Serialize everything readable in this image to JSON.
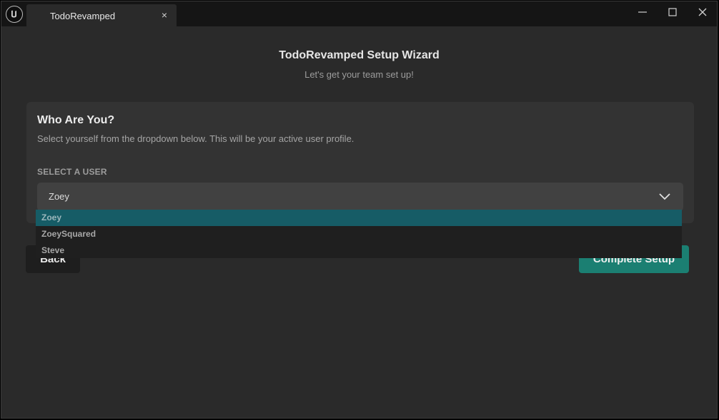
{
  "window": {
    "tab_title": "TodoRevamped",
    "tab_close": "×"
  },
  "wizard": {
    "title": "TodoRevamped Setup Wizard",
    "subtitle": "Let's get your team set up!"
  },
  "card": {
    "title": "Who Are You?",
    "description": "Select yourself from the dropdown below. This will be your active user profile.",
    "field_label": "SELECT A USER",
    "selected_value": "Zoey"
  },
  "dropdown": {
    "options": [
      "Zoey",
      "ZoeySquared",
      "Steve"
    ],
    "selected_index": 0
  },
  "actions": {
    "back_label": "Back",
    "complete_label": "Complete Setup"
  },
  "colors": {
    "background": "#2a2a2a",
    "accent": "#1b7f72",
    "selected_option": "#165c66"
  }
}
